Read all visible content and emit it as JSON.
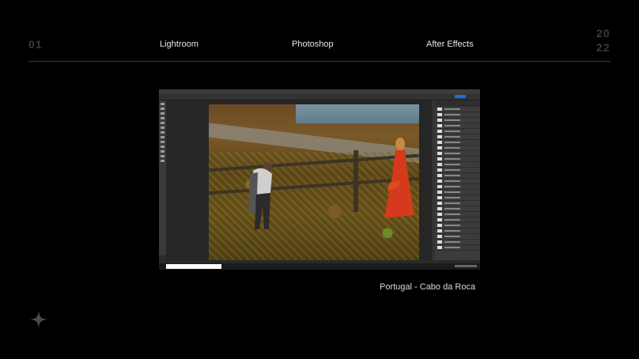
{
  "header": {
    "index": "01",
    "year_top": "20",
    "year_bottom": "22",
    "nav": [
      "Lightroom",
      "Photoshop",
      "After Effects"
    ]
  },
  "caption": "Portugal - Cabo da Roca",
  "icons": {
    "decoration": "sparkle-icon"
  },
  "colors": {
    "background": "#000000",
    "muted_number": "#3a3a3a",
    "text": "#e8e8e8",
    "accent_button": "#1473e6"
  }
}
